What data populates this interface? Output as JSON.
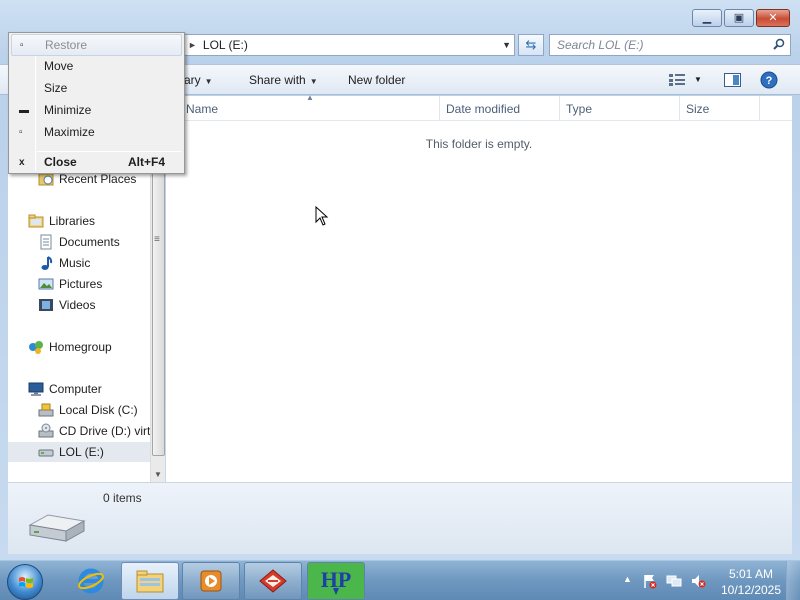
{
  "window": {
    "minimize_glyph": "▁",
    "maximize_glyph": "▣",
    "close_glyph": "✕"
  },
  "address": {
    "crumb_arrow": "►",
    "path": "LOL (E:)",
    "dropdown_glyph": "▼",
    "refresh_glyph": "⇆"
  },
  "search": {
    "placeholder": "Search LOL (E:)"
  },
  "toolbar": {
    "include_library_partial": "rary",
    "share_with": "Share with",
    "new_folder": "New folder",
    "arrow": "▼"
  },
  "nav": {
    "items": [
      {
        "label": "Recent Places",
        "icon": "recent-places-icon"
      },
      {
        "label": "Libraries",
        "icon": "libraries-icon"
      },
      {
        "label": "Documents",
        "icon": "documents-icon"
      },
      {
        "label": "Music",
        "icon": "music-icon"
      },
      {
        "label": "Pictures",
        "icon": "pictures-icon"
      },
      {
        "label": "Videos",
        "icon": "videos-icon"
      },
      {
        "label": "Homegroup",
        "icon": "homegroup-icon"
      },
      {
        "label": "Computer",
        "icon": "computer-icon"
      },
      {
        "label": "Local Disk (C:)",
        "icon": "local-disk-icon"
      },
      {
        "label": "CD Drive (D:) virt",
        "icon": "cd-drive-icon"
      },
      {
        "label": "LOL (E:)",
        "icon": "usb-drive-icon"
      }
    ],
    "selected": "LOL (E:)"
  },
  "content": {
    "columns": [
      "Name",
      "Date modified",
      "Type",
      "Size"
    ],
    "empty_message": "This folder is empty."
  },
  "details": {
    "item_count": "0 items"
  },
  "system_menu": {
    "items": [
      {
        "label": "Restore",
        "icon": "restore-icon",
        "glyph": "▫",
        "disabled": true
      },
      {
        "label": "Move",
        "icon": "",
        "glyph": "",
        "disabled": false
      },
      {
        "label": "Size",
        "icon": "",
        "glyph": "",
        "disabled": false
      },
      {
        "label": "Minimize",
        "icon": "minimize-icon",
        "glyph": "▬",
        "disabled": false
      },
      {
        "label": "Maximize",
        "icon": "maximize-icon",
        "glyph": "▫",
        "disabled": false
      },
      {
        "label": "Close",
        "icon": "close-icon",
        "glyph": "x",
        "disabled": false,
        "shortcut": "Alt+F4"
      }
    ]
  },
  "taskbar": {
    "clock_time": "5:01 AM",
    "clock_date": "10/12/2025",
    "show_hidden_glyph": "▲",
    "hp_text": "HP"
  },
  "colors": {
    "accent": "#3f89cf",
    "window_frame": "#b9d1ea",
    "close_red": "#c84c33"
  }
}
